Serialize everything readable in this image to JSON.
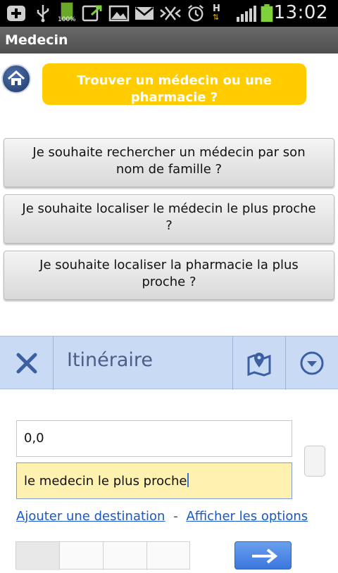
{
  "status_bar": {
    "time": "13:02",
    "battery_small_label": "100%",
    "network_label": "H",
    "icons": [
      "add-icon",
      "usb-icon",
      "battery-full-icon",
      "screenshot-icon",
      "image-icon",
      "mail-icon",
      "vibrate-icon",
      "alarm-icon",
      "network-h-icon",
      "signal-icon",
      "battery-icon"
    ]
  },
  "app": {
    "title": "Medecin"
  },
  "header": {
    "find_button": "Trouver un médecin ou une pharmacie ?"
  },
  "questions": [
    {
      "label": "Je souhaite rechercher un médecin par son nom de famille ?"
    },
    {
      "label": "Je souhaite localiser le médecin le plus proche ?"
    },
    {
      "label": "Je souhaite localiser la pharmacie la plus proche ?"
    }
  ],
  "itinerary": {
    "title": "Itinéraire",
    "origin_value": "0,0",
    "destination_value": "le medecin le plus proche",
    "add_destination": "Ajouter une destination",
    "separator": "-",
    "show_options": "Afficher les options"
  },
  "colors": {
    "accent_yellow": "#ffcc00",
    "itinerary_bar": "#c9daf5",
    "link_blue": "#1a57c7"
  }
}
